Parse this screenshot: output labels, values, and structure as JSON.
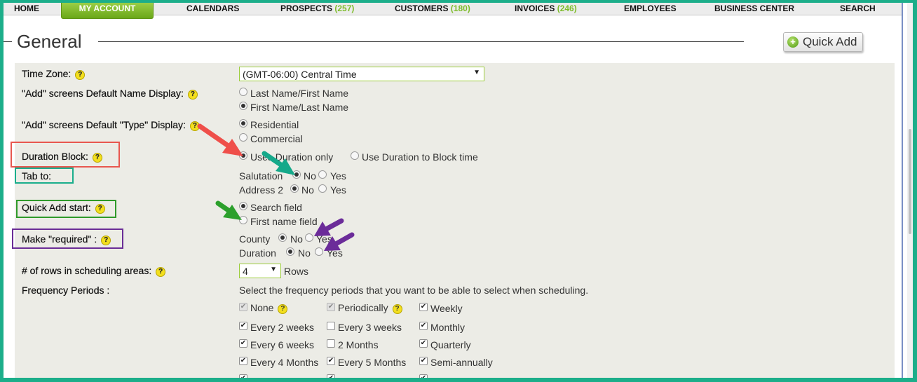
{
  "nav": {
    "home": "HOME",
    "my_account": "MY ACCOUNT",
    "calendars": "CALENDARS",
    "prospects": "PROSPECTS",
    "prospects_count": "(257)",
    "customers": "CUSTOMERS",
    "customers_count": "(180)",
    "invoices": "INVOICES",
    "invoices_count": "(246)",
    "employees": "EMPLOYEES",
    "business_center": "BUSINESS CENTER",
    "search": "SEARCH"
  },
  "page": {
    "title": "General",
    "quick_add": "Quick Add"
  },
  "settings": {
    "help_glyph": "?",
    "time_zone_label": "Time Zone:",
    "time_zone_value": "(GMT-06:00) Central Time",
    "name_display_label": "\"Add\" screens Default Name Display:",
    "name_display_options": [
      "Last Name/First Name",
      "First Name/Last Name"
    ],
    "type_display_label": "\"Add\" screens Default \"Type\" Display:",
    "type_display_options": [
      "Residential",
      "Commercial"
    ],
    "duration_block_label": "Duration Block:",
    "duration_block_options": [
      "Uses Duration only",
      "Use Duration to Block time"
    ],
    "tab_to_label": "Tab to:",
    "tab_to_rows": [
      {
        "name": "Salutation",
        "no": "No",
        "yes": "Yes"
      },
      {
        "name": "Address 2",
        "no": "No",
        "yes": "Yes"
      }
    ],
    "quick_add_start_label": "Quick Add start:",
    "quick_add_start_options": [
      "Search field",
      "First name field"
    ],
    "make_required_label": "Make \"required\" :",
    "make_required_rows": [
      {
        "name": "County",
        "no": "No",
        "yes": "Yes"
      },
      {
        "name": "Duration",
        "no": "No",
        "yes": "Yes"
      }
    ],
    "rows_label": "# of rows in scheduling areas:",
    "rows_value": "4",
    "rows_suffix": "Rows",
    "frequency_label": "Frequency Periods :",
    "frequency_note": "Select the frequency periods that you want to be able to select when scheduling.",
    "frequency_rows": [
      [
        "None",
        "Periodically",
        "Weekly"
      ],
      [
        "Every 2 weeks",
        "Every 3 weeks",
        "Monthly"
      ],
      [
        "Every 6 weeks",
        "2 Months",
        "Quarterly"
      ],
      [
        "Every 4 Months",
        "Every 5 Months",
        "Semi-annually"
      ]
    ]
  },
  "colors": {
    "frame": "#1cae8a",
    "box_red": "#e8574f",
    "box_teal": "#1aae8c",
    "box_green": "#2f9a2a",
    "box_purple": "#6a2d96",
    "arrow_red": "#ef4f4a",
    "arrow_teal": "#15a98a",
    "arrow_green": "#2ca02c",
    "arrow_purple": "#6b2c99"
  }
}
